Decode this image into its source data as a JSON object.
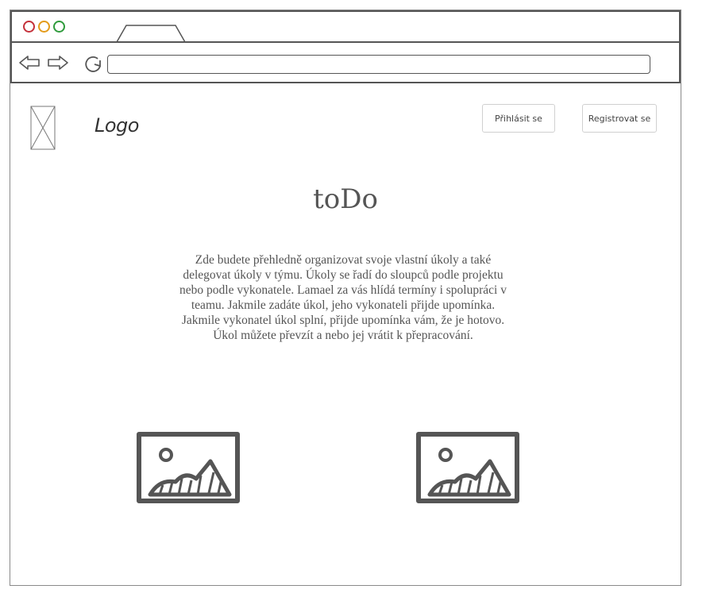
{
  "header": {
    "logo_text": "Logo",
    "login_label": "Přihlásit se",
    "register_label": "Registrovat se"
  },
  "main": {
    "title": "toDo",
    "description": "Zde budete přehledně organizovat svoje vlastní úkoly a také delegovat úkoly v týmu. Úkoly se řadí do sloupců podle projektu nebo podle vykonatele. Lamael za vás hlídá termíny i spolupráci v teamu. Jakmile zadáte úkol, jeho vykonateli přijde upomínka. Jakmile vykonatel úkol splní, přijde upomínka vám, že je hotovo. Úkol můžete převzít a nebo jej vrátit k přepracování."
  },
  "icons": {
    "window_controls": [
      "close-dot",
      "minimize-dot",
      "maximize-dot"
    ],
    "nav": [
      "back-arrow-icon",
      "forward-arrow-icon",
      "reload-icon"
    ],
    "placeholders": [
      "image-placeholder-icon",
      "image-placeholder-icon"
    ]
  },
  "colors": {
    "close": "#c4303a",
    "minimize": "#e39b1a",
    "maximize": "#2f9b3c",
    "sketch": "#555555"
  }
}
